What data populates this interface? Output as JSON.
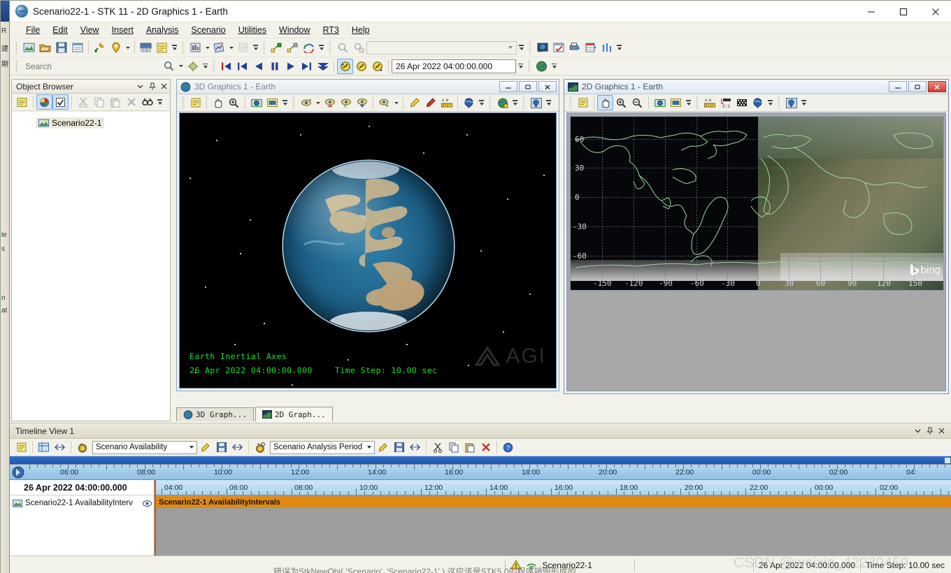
{
  "window": {
    "title": "Scenario22-1 - STK 11 - 2D Graphics 1 - Earth",
    "app_icon": "stk-globe-icon",
    "minimize_label": "–",
    "maximize_label": "□",
    "close_label": "✕"
  },
  "menubar": {
    "items": [
      {
        "label": "File",
        "accel": "F"
      },
      {
        "label": "Edit",
        "accel": "E"
      },
      {
        "label": "View",
        "accel": "V"
      },
      {
        "label": "Insert",
        "accel": "I"
      },
      {
        "label": "Analysis",
        "accel": "A"
      },
      {
        "label": "Scenario",
        "accel": "S"
      },
      {
        "label": "Utilities",
        "accel": "U"
      },
      {
        "label": "Window",
        "accel": "W"
      },
      {
        "label": "RT3",
        "accel": "R"
      },
      {
        "label": "Help",
        "accel": "H"
      }
    ]
  },
  "search": {
    "placeholder": "Search",
    "search_icon": "magnifier-icon",
    "settings_icon": "gear-icon"
  },
  "animation": {
    "current_time": "26 Apr 2022 04:00:00.000",
    "buttons": [
      {
        "name": "reset-button"
      },
      {
        "name": "step-back-button"
      },
      {
        "name": "play-backward-button"
      },
      {
        "name": "pause-button"
      },
      {
        "name": "play-forward-button"
      },
      {
        "name": "step-forward-button"
      },
      {
        "name": "increase-speed-button"
      }
    ],
    "clock_buttons": [
      {
        "name": "animation-start-clock-icon"
      },
      {
        "name": "animation-time-clock-icon"
      },
      {
        "name": "animation-end-clock-icon"
      }
    ]
  },
  "object_browser": {
    "title": "Object Browser",
    "dropdown_icon": "chevron-down-icon",
    "pin_icon": "pin-icon",
    "close_icon": "close-icon",
    "toolbar": [
      {
        "name": "properties-icon"
      },
      {
        "name": "color-wheel-icon"
      },
      {
        "name": "checkmark-icon"
      },
      {
        "name": "cut-icon"
      },
      {
        "name": "copy-icon"
      },
      {
        "name": "paste-icon"
      },
      {
        "name": "delete-icon"
      },
      {
        "name": "find-icon"
      }
    ],
    "tree": [
      {
        "label": "Scenario22-1",
        "icon": "scenario-icon"
      }
    ]
  },
  "graphics_3d": {
    "title": "3D Graphics 1 - Earth",
    "icon": "globe-3d-icon",
    "minimize_label": "–",
    "restore_label": "▫",
    "close_label": "✕",
    "overlay_axes": "Earth Inertial Axes",
    "overlay_time": "26 Apr 2022 04:00:00.000",
    "overlay_step": "Time Step: 10.00 sec",
    "watermark": "AGI",
    "toolbar": [
      {
        "name": "properties-icon"
      },
      {
        "name": "pan-hand-icon"
      },
      {
        "name": "zoom-in-icon"
      },
      {
        "name": "snapshot-icon"
      },
      {
        "name": "record-icon"
      },
      {
        "name": "view-from-to-icon"
      },
      {
        "name": "home-view-icon"
      },
      {
        "name": "north-view-icon"
      },
      {
        "name": "down-view-icon"
      },
      {
        "name": "view-target-icon"
      },
      {
        "name": "highlight-pen-icon"
      },
      {
        "name": "draw-line-icon"
      },
      {
        "name": "measure-distance-icon"
      },
      {
        "name": "globe-overlay-icon"
      },
      {
        "name": "earth-map-icon"
      },
      {
        "name": "globe-download-icon"
      }
    ]
  },
  "graphics_2d": {
    "title": "2D Graphics 1 - Earth",
    "icon": "map-2d-icon",
    "minimize_label": "–",
    "restore_label": "▫",
    "close_label": "✕",
    "toolbar": [
      {
        "name": "properties-icon"
      },
      {
        "name": "pan-hand-icon"
      },
      {
        "name": "zoom-in-icon"
      },
      {
        "name": "zoom-out-icon"
      },
      {
        "name": "snapshot-icon"
      },
      {
        "name": "record-icon"
      },
      {
        "name": "measure-distance-icon"
      },
      {
        "name": "scale-ratio-icon"
      },
      {
        "name": "grid-icon"
      },
      {
        "name": "globe-overlay-icon"
      },
      {
        "name": "globe-download-icon"
      }
    ],
    "latitude_labels": [
      "60",
      "30",
      "0",
      "-30",
      "-60"
    ],
    "longitude_labels": [
      "-150",
      "-120",
      "-90",
      "-60",
      "-30",
      "0",
      "30",
      "60",
      "90",
      "120",
      "150"
    ],
    "imagery_watermark": "bing"
  },
  "mdi_tabs": [
    {
      "label": "3D Graph...",
      "icon": "globe-3d-icon",
      "selected": false
    },
    {
      "label": "2D Graph...",
      "icon": "map-2d-icon",
      "selected": true
    }
  ],
  "timeline": {
    "title": "Timeline View 1",
    "dropdown_icon": "chevron-down-icon",
    "pin_icon": "pin-icon",
    "close_icon": "close-icon",
    "toolbar": {
      "properties_icon": "properties-icon",
      "view_icon": "timeline-view-icon",
      "availability_icon": "availability-clock-icon",
      "availability_value": "Scenario Availability",
      "analysis_icon": "analysis-clock-icon",
      "analysis_value": "Scenario Analysis Period",
      "edit_icon": "pencil-icon",
      "save_icon": "save-icon",
      "fit_icon": "fit-icon",
      "cut_icon": "cut-icon",
      "copy_icon": "copy-icon",
      "paste_icon": "paste-icon",
      "delete_icon": "delete-red-x-icon",
      "help_icon": "help-icon"
    },
    "current_time_label": "26 Apr 2022 04:00:00.000",
    "ruler_top": [
      "06:00",
      "08:00",
      "10:00",
      "12:00",
      "14:00",
      "16:00",
      "18:00",
      "20:00",
      "22:00",
      "00:00",
      "02:00",
      "04:"
    ],
    "ruler_bottom": [
      "04:00",
      "06:00",
      "08:00",
      "10:00",
      "12:00",
      "14:00",
      "16:00",
      "18:00",
      "20:00",
      "22:00",
      "00:00",
      "02:00"
    ],
    "object_row": {
      "label": "Scenario22-1 AvailabilityInterv",
      "icon": "scenario-icon",
      "eye_icon": "eye-icon"
    },
    "interval_band": {
      "label": "Scenario22-1 AvailabilityIntervals",
      "color": "#e08a16"
    }
  },
  "statusbar": {
    "warning_icon": "warning-triangle-icon",
    "connect_icon": "connect-antenna-icon",
    "scenario_name": "Scenario22-1",
    "time": "26 Apr 2022 04:00:00.000",
    "time_step": "Time Step: 10.00 sec"
  },
  "watermarks": {
    "csdn": "CSDN @weixin_42230459",
    "cjk_bottom": "错误为StkNewObj( 'Scenario', 'Scenario22-1' ) 这应该是STK5.0的程序销毁形成的"
  },
  "behind_window": {
    "fragments": [
      "R",
      "建",
      "期",
      "le",
      "s",
      "n",
      "at"
    ]
  },
  "colors": {
    "accent_blue": "#2f6fd0",
    "band_orange": "#e08a16",
    "overlay_green": "#19e028",
    "close_red": "#cf3b31"
  }
}
